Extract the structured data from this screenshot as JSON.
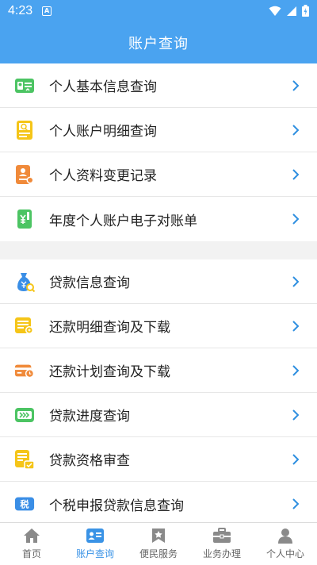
{
  "status_bar": {
    "time": "4:23",
    "app_badge": "A"
  },
  "header": {
    "title": "账户查询"
  },
  "colors": {
    "accent": "#4aa3f0",
    "active_tab": "#3a93e6"
  },
  "section_a": [
    {
      "label": "个人基本信息查询",
      "icon": "id-card-icon"
    },
    {
      "label": "个人账户明细查询",
      "icon": "document-search-icon"
    },
    {
      "label": "个人资料变更记录",
      "icon": "profile-change-icon"
    },
    {
      "label": "年度个人账户电子对账单",
      "icon": "yuan-statement-icon"
    }
  ],
  "section_b": [
    {
      "label": "贷款信息查询",
      "icon": "money-bag-search-icon"
    },
    {
      "label": "还款明细查询及下载",
      "icon": "repayment-detail-icon"
    },
    {
      "label": "还款计划查询及下载",
      "icon": "repayment-plan-icon"
    },
    {
      "label": "贷款进度查询",
      "icon": "loan-progress-icon"
    },
    {
      "label": "贷款资格审查",
      "icon": "qualification-review-icon"
    },
    {
      "label": "个税申报贷款信息查询",
      "icon": "tax-icon"
    }
  ],
  "tax_icon_text": "税",
  "bottom_nav": [
    {
      "label": "首页",
      "icon": "home-icon",
      "active": false
    },
    {
      "label": "账户查询",
      "icon": "account-card-icon",
      "active": true
    },
    {
      "label": "便民服务",
      "icon": "bookmark-star-icon",
      "active": false
    },
    {
      "label": "业务办理",
      "icon": "briefcase-icon",
      "active": false
    },
    {
      "label": "个人中心",
      "icon": "person-icon",
      "active": false
    }
  ]
}
